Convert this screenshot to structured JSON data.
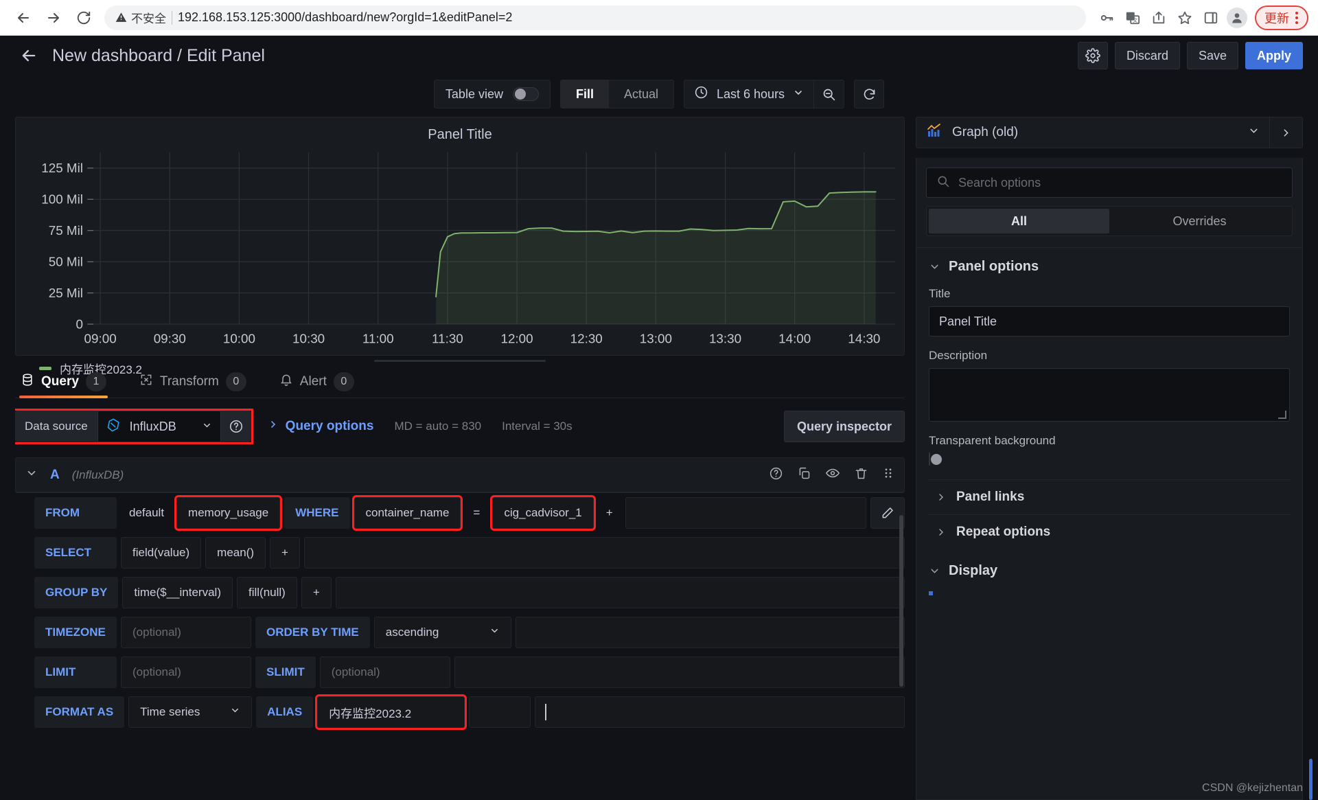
{
  "browser": {
    "security_label": "不安全",
    "url": "192.168.153.125:3000/dashboard/new?orgId=1&editPanel=2",
    "back_icon": "back-arrow-icon",
    "forward_icon": "forward-arrow-icon",
    "reload_icon": "reload-icon",
    "update_label": "更新",
    "icons": [
      "password-key-icon",
      "translate-icon",
      "share-icon",
      "bookmark-star-icon",
      "side-panel-icon",
      "profile-avatar-icon"
    ]
  },
  "header": {
    "title": "New dashboard / Edit Panel",
    "back_icon": "back-arrow-icon",
    "settings_icon": "gear-icon",
    "discard_label": "Discard",
    "save_label": "Save",
    "apply_label": "Apply"
  },
  "toolbar": {
    "table_view_label": "Table view",
    "table_view_on": false,
    "fill_label": "Fill",
    "actual_label": "Actual",
    "fill_active": true,
    "time_range": "Last 6 hours",
    "clock_icon": "clock-icon",
    "zoom_out_icon": "zoom-out-icon",
    "refresh_icon": "refresh-icon"
  },
  "panel": {
    "title": "Panel Title",
    "legend_label": "内存监控2023.2",
    "series_color": "#7eb26d"
  },
  "chart_data": {
    "type": "line",
    "title": "Panel Title",
    "xlabel": "",
    "ylabel": "",
    "ylim": [
      0,
      137500000
    ],
    "grid": true,
    "legend_position": "bottom-left",
    "ytick_labels": [
      "0",
      "25 Mil",
      "50 Mil",
      "75 Mil",
      "100 Mil",
      "125 Mil"
    ],
    "ytick_values": [
      0,
      25000000,
      50000000,
      75000000,
      100000000,
      125000000
    ],
    "xtick_labels": [
      "09:00",
      "09:30",
      "10:00",
      "10:30",
      "11:00",
      "11:30",
      "12:00",
      "12:30",
      "13:00",
      "13:30",
      "14:00",
      "14:30"
    ],
    "series": [
      {
        "name": "内存监控2023.2",
        "color": "#7eb26d",
        "x": [
          "11:25",
          "11:27",
          "11:30",
          "11:33",
          "11:36",
          "11:40",
          "11:45",
          "11:50",
          "11:55",
          "12:00",
          "12:05",
          "12:10",
          "12:15",
          "12:20",
          "12:25",
          "12:30",
          "12:35",
          "12:40",
          "12:45",
          "12:50",
          "12:55",
          "13:00",
          "13:05",
          "13:10",
          "13:15",
          "13:20",
          "13:25",
          "13:30",
          "13:35",
          "13:40",
          "13:45",
          "13:50",
          "13:55",
          "14:00",
          "14:05",
          "14:10",
          "14:15",
          "14:20",
          "14:25",
          "14:30",
          "14:35"
        ],
        "values": [
          22000000,
          58000000,
          70000000,
          72500000,
          73000000,
          73000000,
          73200000,
          73200000,
          73300000,
          73400000,
          76500000,
          77000000,
          77000000,
          74500000,
          74200000,
          74300000,
          74400000,
          73200000,
          74600000,
          73300000,
          74500000,
          74600000,
          74500000,
          74500000,
          76200000,
          75800000,
          75000000,
          75200000,
          75400000,
          76600000,
          76400000,
          76500000,
          98000000,
          98500000,
          94000000,
          94500000,
          105000000,
          105500000,
          105800000,
          106000000,
          106000000
        ]
      }
    ]
  },
  "tabs": [
    {
      "label": "Query",
      "count": "1",
      "icon": "database-icon",
      "active": true
    },
    {
      "label": "Transform",
      "count": "0",
      "icon": "transform-icon",
      "active": false
    },
    {
      "label": "Alert",
      "count": "0",
      "icon": "bell-icon",
      "active": false
    }
  ],
  "datasource_row": {
    "label": "Data source",
    "value": "InfluxDB",
    "icon": "influxdb-icon",
    "help_icon": "help-circle-icon",
    "query_options_label": "Query options",
    "md_text": "MD = auto = 830",
    "interval_text": "Interval = 30s",
    "query_inspector_label": "Query inspector"
  },
  "query": {
    "letter": "A",
    "datasource": "(InfluxDB)",
    "actions": [
      "help-circle-icon",
      "duplicate-icon",
      "eye-icon",
      "trash-icon",
      "drag-handle-icon"
    ],
    "rows": [
      {
        "keyword": "FROM",
        "segments": [
          {
            "text": "default",
            "type": "plain"
          },
          {
            "text": "memory_usage",
            "type": "value",
            "highlight": true
          },
          {
            "text": "WHERE",
            "type": "keyword"
          },
          {
            "text": "container_name",
            "type": "value",
            "highlight": true
          },
          {
            "text": "=",
            "type": "plain"
          },
          {
            "text": "cig_cadvisor_1",
            "type": "value",
            "highlight": true
          },
          {
            "text": "+",
            "type": "plain"
          }
        ]
      },
      {
        "keyword": "SELECT",
        "segments": [
          {
            "text": "field(value)",
            "type": "value"
          },
          {
            "text": "mean()",
            "type": "value"
          },
          {
            "text": "+",
            "type": "plain"
          }
        ]
      },
      {
        "keyword": "GROUP BY",
        "segments": [
          {
            "text": "time($__interval)",
            "type": "value"
          },
          {
            "text": "fill(null)",
            "type": "value"
          },
          {
            "text": "+",
            "type": "plain"
          }
        ]
      }
    ],
    "timezone_label": "TIMEZONE",
    "timezone_placeholder": "(optional)",
    "order_by_label": "ORDER BY TIME",
    "order_by_value": "ascending",
    "limit_label": "LIMIT",
    "limit_placeholder": "(optional)",
    "slimit_label": "SLIMIT",
    "slimit_placeholder": "(optional)",
    "format_as_label": "FORMAT AS",
    "format_as_value": "Time series",
    "alias_label": "ALIAS",
    "alias_value": "内存监控2023.2",
    "edit_icon": "pencil-icon"
  },
  "options_pane": {
    "panel_type": "Graph (old)",
    "panel_type_icon": "graph-icon",
    "search_placeholder": "Search options",
    "search_icon": "search-icon",
    "tab_all": "All",
    "tab_overrides": "Overrides",
    "panel_options_header": "Panel options",
    "title_label": "Title",
    "title_value": "Panel Title",
    "description_label": "Description",
    "description_value": "",
    "transparent_label": "Transparent background",
    "transparent_on": false,
    "panel_links_label": "Panel links",
    "repeat_options_label": "Repeat options",
    "display_header": "Display"
  },
  "watermark": "CSDN @kejizhentan"
}
